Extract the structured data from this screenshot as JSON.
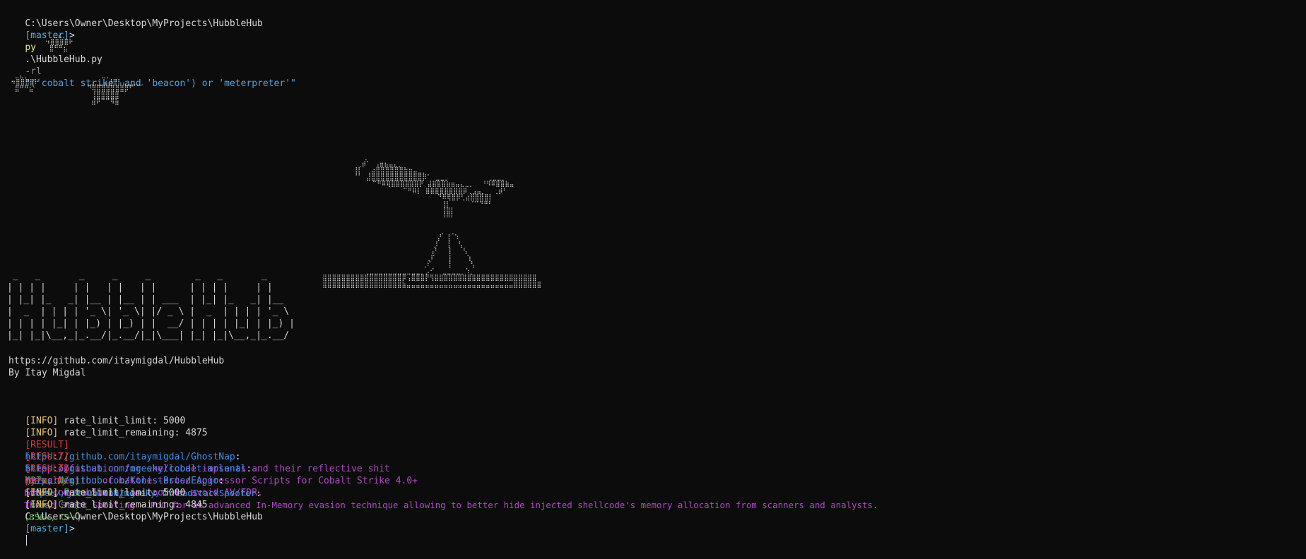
{
  "prompt": {
    "path": "C:\\Users\\Owner\\Desktop\\MyProjects\\HubbleHub",
    "branch": "[master]",
    "symbol": ">"
  },
  "command": {
    "exe": "py",
    "script": ".\\HubbleHub.py",
    "flag": "-rl",
    "query": "\"('cobalt strike' and 'beacon') or 'meterpreter'\""
  },
  "banner": {
    "stars_art": "            ⣀⣄⡀\n          ⠲⣿⣿⣿⣿⠗\n           ⣿⠛⠛⣦\n\n\n\n  ⣀⣄⡀                   ⣀⡀\n ⠲⣿⣿⣿⣿⠗            ⢀⣀⣀⣀⣠⣼⣿⣧⣄⣀⣀⣀⡀\n  ⣿⠛⠛⣦              ⠙⢿⣿⣿⣿⣿⣿⣿⡿⠋\n                      ⢸⣿⣿⣿⣿⣿\n                      ⣾⠟⠉⠉⠻⣷",
    "telescope_art": "              ⡀\n            ⢀⡾⠁ ⢠⣶⣦⣤⣄⡀\n           ⢸⡇ ⢀⣴⣿⣿⣿⣿⣿⣿⣷⣶⣤⣀⡀\n           ⠈⠁ ⣼⣿⣿⣿⣿⣿⣿⣿⣿⣿⣿⣿⡿⠁ ⣀⣀⡀          ⢀⣀⣀⡀\n                ⠉⠛⠿⢿⣿⣿⣿⣿⣿⣿⡟ ⣼⣿⣿⣿⣷⣶⣤⣄⣀⡀  ⠘⠻⠿⣿⣿⣷⣤\n                        ⠉⠛⠿⡇ ⣿⣿⣿⣿⣿⣿⣿⣿⡿⢀⣠⣤⡀  ⢀⡾⠃\n                                 ⠙⠿⢿⣿⡿⢃⣴⣿⣿⣿⣿⡇\n                                  ⢸⡇     ⠈⠉⠙⠛⠃\n                                  ⢸⣿⡇\n                                  ⠘⠛⠃\n\n                                  ⡀ ⢀\n                                 ⡜ ⢸ ⠱\n                                ⡸  ⢸  ⢣\n                               ⢠⠃  ⢸   ⢣\n                              ⢀⠏   ⢸    ⢱\n                             ⢀⠎    ⢸     ⢣\n              ⢀⣀⣀⣀⣀⣀⣀⣀⣀⣀⣀⣀⡀⡠⠊  ⣀⣀⣀⣀⡀⠱⡀\n   ⣿⣿⣿⣿⣿⣿⣿⣿⣿⣿⣿⣿⣿⣿⣿⣿⣿⡿⢠⣿⣿⣿⡟⢻⣿⣿⣿⣿⣿⣿⣿⣿⣿⣿⣿⣿⣿⣿⣿⣿⣿⣿⣿⣿⣿⣿\n   ⣿⣿⣿⣿⣿⣿⣿⣿⣿⣿⣿⣿⣿⣿⣿⣿⣿⣷⣤⣤⣤⣤⣤⣤⣤⣤⣤⣤⣤⣤⣤⣤⣤⣤⣤⣤⣤⣤⣤⣤⣤⣿⣿⣿⣿⣿⣿",
    "logo_art": " _   _       _     _     _        _   _       _     \n| | | |     | |   | |   | |      | | | |     | |    \n| |_| |_   _| |__ | |__ | | ___  | |_| |_   _| |__  \n|  _  | | | | '_ \\| '_ \\| |/ _ \\ |  _  | | | | '_ \\ \n| | | | |_| | |_) | |_) | |  __/ | | | | |_| | |_) |\n|_| |_|\\__,_|_.__/|_.__/|_|\\___| |_| |_|\\__,_|_.__/ ",
    "url": "https://github.com/itaymigdal/HubbleHub",
    "author": "By Itay Migdal"
  },
  "output": [
    {
      "tag": "[INFO]",
      "text": " rate_limit_limit: 5000"
    },
    {
      "tag": "[INFO]",
      "text": " rate_limit_remaining: 4875"
    },
    {
      "tag": "[RESULT]",
      "url": "https://github.com/itaymigdal/GhostNap",
      "desc": "Sleep obfuscation for shellcode implants and their reflective shit",
      "meta": "(27★, Nim)"
    },
    {
      "tag": "[RESULT]",
      "url": "https://github.com/mgeeky/cobalt-arsenal",
      "desc": "My collection of battle-tested Aggressor Scripts for Cobalt Strike 4.0+",
      "meta": "(869★, PowerShell)"
    },
    {
      "tag": "[RESULT]",
      "url": "https://github.com/Konis-Bros/Espio",
      "desc": "Shellcode obfuscation tool to avoid AV/EDR.",
      "meta": "(62★, C++)"
    },
    {
      "tag": "[RESULT]",
      "url": "https://github.com/mgeeky/ThreadStackSpoofer",
      "desc": "Thread Stack Spoofing - PoC for an advanced In-Memory evasion technique allowing to better hide injected shellcode's memory allocation from scanners and analysts.",
      "meta": "(856★, C++)"
    },
    {
      "tag": "[INFO]",
      "text": " rate_limit_limit: 5000"
    },
    {
      "tag": "[INFO]",
      "text": " rate_limit_remaining: 4845"
    }
  ],
  "colors": {
    "background": "#0c0c0c",
    "info": "#e5c07b",
    "result": "#d83b3b",
    "link": "#3b8eea",
    "description": "#b048c8",
    "meta": "#45b03a",
    "branch": "#4fb3f0"
  }
}
